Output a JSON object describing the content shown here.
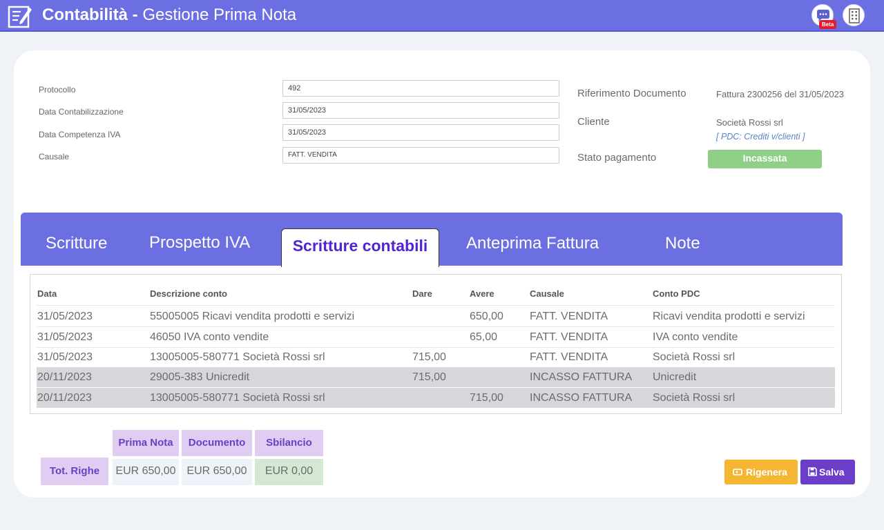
{
  "header": {
    "title_bold": "Contabilità - ",
    "title_rest": "Gestione Prima Nota",
    "beta_badge": "Beta",
    "icons": [
      "document-edit-icon",
      "feedback-icon",
      "building-icon"
    ]
  },
  "form": {
    "protocollo_label": "Protocollo",
    "protocollo_value": "492",
    "data_contabilizzazione_label": "Data Contabilizzazione",
    "data_contabilizzazione_value": "31/05/2023",
    "data_competenza_label": "Data Competenza IVA",
    "data_competenza_value": "31/05/2023",
    "causale_label": "Causale",
    "causale_value": "FATT. VENDITA"
  },
  "info": {
    "riferimento_label": "Riferimento Documento",
    "riferimento_value": "Fattura 2300256 del 31/05/2023",
    "cliente_label": "Cliente",
    "cliente_value": "Società Rossi srl",
    "pdc_value": "[ PDC: Crediti v/clienti ]",
    "stato_label": "Stato pagamento",
    "stato_value": "Incassata"
  },
  "tabs": [
    {
      "label": "Scritture",
      "active": false
    },
    {
      "label": "Prospetto IVA",
      "active": false
    },
    {
      "label": "Scritture contabili",
      "active": true
    },
    {
      "label": "Anteprima Fattura",
      "active": false
    },
    {
      "label": "Note",
      "active": false
    }
  ],
  "table": {
    "columns": [
      "Data",
      "Descrizione conto",
      "Dare",
      "Avere",
      "Causale",
      "Conto PDC"
    ],
    "rows": [
      {
        "data": "31/05/2023",
        "descrizione": "55005005 Ricavi vendita prodotti e servizi",
        "dare": "",
        "avere": "650,00",
        "causale": "FATT. VENDITA",
        "conto": "Ricavi vendita prodotti e servizi",
        "shaded": false
      },
      {
        "data": "31/05/2023",
        "descrizione": "46050 IVA conto vendite",
        "dare": "",
        "avere": "65,00",
        "causale": "FATT. VENDITA",
        "conto": "IVA conto vendite",
        "shaded": false
      },
      {
        "data": "31/05/2023",
        "descrizione": "13005005-580771 Società Rossi srl",
        "dare": "715,00",
        "avere": "",
        "causale": "FATT. VENDITA",
        "conto": "Società Rossi srl",
        "shaded": false
      },
      {
        "data": "20/11/2023",
        "descrizione": "29005-383 Unicredit",
        "dare": "715,00",
        "avere": "",
        "causale": "INCASSO FATTURA",
        "conto": "Unicredit",
        "shaded": true
      },
      {
        "data": "20/11/2023",
        "descrizione": "13005005-580771 Società Rossi srl",
        "dare": "",
        "avere": "715,00",
        "causale": "INCASSO FATTURA",
        "conto": "Società Rossi srl",
        "shaded": true
      }
    ]
  },
  "totals": {
    "headers": [
      "Prima Nota",
      "Documento",
      "Sbilancio"
    ],
    "row_label": "Tot. Righe",
    "values": [
      "EUR 650,00",
      "EUR 650,00",
      "EUR 0,00"
    ]
  },
  "actions": {
    "rigenera_label": "Rigenera",
    "salva_label": "Salva"
  },
  "colors": {
    "header_bg": "#6b6fe2",
    "active_tab_text": "#5222d6",
    "status_green": "#8fcf87",
    "accent_purple": "#6a3ec9",
    "accent_orange": "#f5b733"
  }
}
